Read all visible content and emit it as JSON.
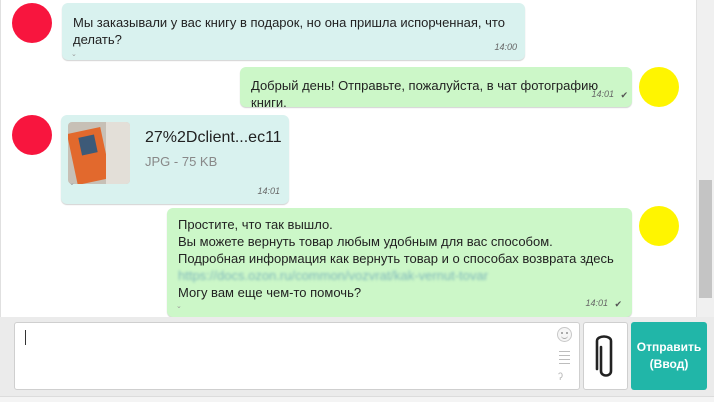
{
  "messages": [
    {
      "direction": "in",
      "lines": [
        "Мы заказывали у вас книгу в подарок, но она пришла испорченная, что",
        "делать?"
      ],
      "time": "14:00"
    },
    {
      "direction": "out",
      "lines": [
        "Добрый день! Отправьте, пожалуйста, в чат фотографию книги."
      ],
      "time": "14:01",
      "status": "✔"
    },
    {
      "direction": "in",
      "file": {
        "name": "27%2Dclient...ec11",
        "meta": "JPG - 75 KB"
      },
      "time": "14:01"
    },
    {
      "direction": "out",
      "lines": [
        "Простите, что так вышло.",
        "Вы можете вернуть товар любым удобным для вас способом.",
        "Подробная информация как вернуть товар и о способах возврата здесь"
      ],
      "link": "https://docs.ozon.ru/common/vozvrat/kak-vernut-tovar",
      "last_line": "Могу вам еще чем-то помочь?",
      "time": "14:01",
      "status": "✔"
    }
  ],
  "composer": {
    "placeholder": "",
    "value": "",
    "send_label_line1": "Отправить",
    "send_label_line2": "(Ввод)"
  },
  "icons": {
    "expand": "chevron-down-icon",
    "read": "check-icon",
    "emoji": "smile-icon",
    "templates": "list-icon",
    "spell": "spellcheck-icon",
    "attach": "paperclip-icon"
  },
  "colors": {
    "incoming_bubble": "#d9f2ef",
    "outgoing_bubble": "#ccf7c8",
    "send_button": "#21b6a8",
    "client_avatar": "#f8153e",
    "agent_avatar": "#fff500"
  }
}
